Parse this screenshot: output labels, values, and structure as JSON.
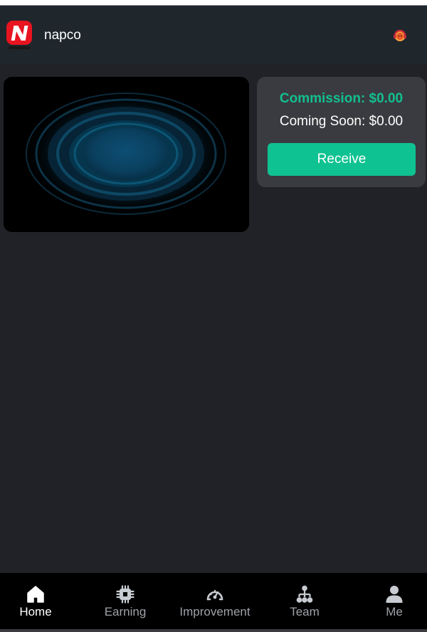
{
  "header": {
    "app_name": "napco",
    "logo_icon": "napco-logo-icon",
    "support_icon": "customer-service-icon"
  },
  "hero": {
    "image": "ripple-rings-animation"
  },
  "commission_card": {
    "commission": "Commission: $0.00",
    "coming_soon": "Coming Soon: $0.00",
    "receive_label": "Receive"
  },
  "nav": {
    "active_color": "#ffffff",
    "inactive_color": "#9ea2a8",
    "items": [
      {
        "label": "Home",
        "icon": "home-icon",
        "active": true
      },
      {
        "label": "Earning",
        "icon": "chip-icon",
        "active": false
      },
      {
        "label": "Improvement",
        "icon": "gauge-icon",
        "active": false
      },
      {
        "label": "Team",
        "icon": "hierarchy-icon",
        "active": false
      },
      {
        "label": "Me",
        "icon": "person-icon",
        "active": false
      }
    ]
  },
  "colors": {
    "accent": "#0fc291",
    "background": "#212227",
    "card": "#3a3b40",
    "header": "#1f262c"
  }
}
